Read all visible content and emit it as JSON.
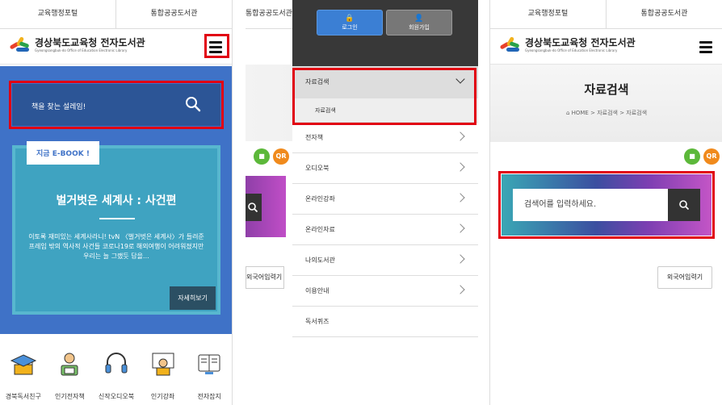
{
  "top_links": [
    "교육행정포털",
    "통합공공도서관"
  ],
  "logo": {
    "title": "경상북도교육청 전자도서관",
    "subtitle": "Gyeongsangbuk-do Office of Education Electronic Library"
  },
  "panel1": {
    "search_placeholder": "책을 찾는 설레임!",
    "ebook": {
      "tab": "지금 E-BOOK !",
      "title": "벌거벗은 세계사 : 사건편",
      "description": "이토록 재미있는 세계사라니! tvN 〈벌거벗은 세계사〉가 들려준 프레임 밖의 역사적 사건들 코로나19로 해외여행이 어려워졌지만 우리는 늘 그랬듯 답을…",
      "more_button": "자세히보기"
    },
    "quick_menu": [
      {
        "label": "경북독서친구",
        "icon": "graduation-icon"
      },
      {
        "label": "인기전자책",
        "icon": "reader-icon"
      },
      {
        "label": "신작오디오북",
        "icon": "headphones-icon"
      },
      {
        "label": "인기강좌",
        "icon": "lecture-icon"
      },
      {
        "label": "전자잡지",
        "icon": "magazine-icon"
      }
    ]
  },
  "panel2": {
    "login_label": "로그인",
    "join_label": "회원가입",
    "menu": [
      {
        "label": "자료검색",
        "active": true,
        "sub": [
          "자료검색"
        ]
      },
      {
        "label": "전자책",
        "chevron": true
      },
      {
        "label": "오디오북",
        "chevron": true
      },
      {
        "label": "온라인강좌",
        "chevron": true
      },
      {
        "label": "온라인자료",
        "chevron": true
      },
      {
        "label": "나의도서관",
        "chevron": true
      },
      {
        "label": "이용안내",
        "chevron": true
      },
      {
        "label": "독서퀴즈",
        "chevron": false
      }
    ],
    "foreign_input_label": "외국어입력기"
  },
  "panel3": {
    "page_title": "자료검색",
    "breadcrumb": [
      "HOME",
      "자료검색",
      "자료검색"
    ],
    "search_placeholder": "검색어를 입력하세요.",
    "foreign_input_label": "외국어입력기",
    "qr_label": "QR"
  },
  "colors": {
    "highlight": "#e10012",
    "hero_blue": "#3f72c7",
    "ebook_teal": "#3fa3c1",
    "login_blue": "#3b7fd4",
    "print_green": "#5cb83a",
    "qr_orange": "#f08a1c"
  }
}
